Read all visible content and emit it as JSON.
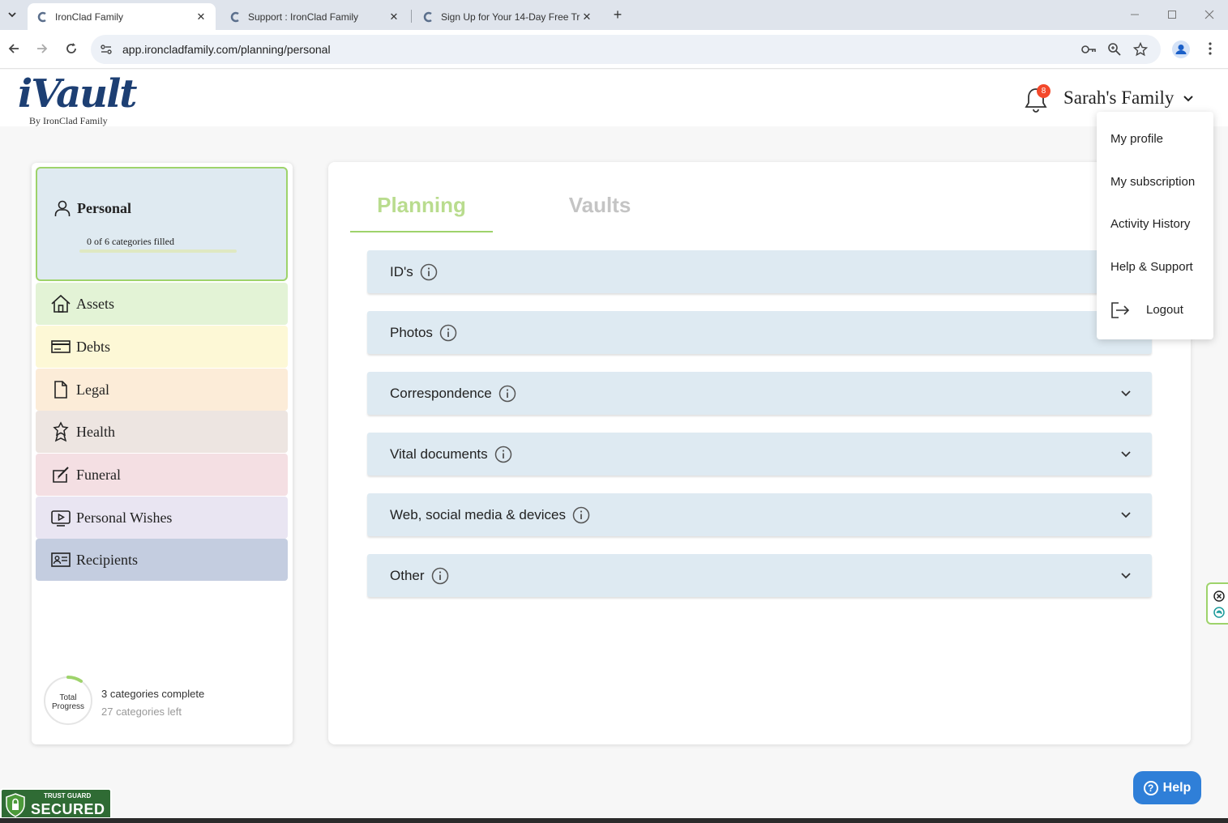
{
  "browser": {
    "tabs": [
      {
        "title": "IronClad Family",
        "active": true
      },
      {
        "title": "Support : IronClad Family",
        "active": false
      },
      {
        "title": "Sign Up for Your 14-Day Free Tr",
        "active": false
      }
    ],
    "url": "app.ironcladfamily.com/planning/personal"
  },
  "header": {
    "logo_main": "iVault",
    "logo_sub": "By IronClad Family",
    "notification_count": "8",
    "family_name": "Sarah's Family"
  },
  "sidebar": {
    "personal": {
      "title": "Personal",
      "subtitle": "0 of 6 categories filled",
      "progress_fraction": 0
    },
    "items": [
      {
        "label": "Assets",
        "icon": "house-icon",
        "color": "#e3f3d6"
      },
      {
        "label": "Debts",
        "icon": "credit-card-icon",
        "color": "#fdf8d6"
      },
      {
        "label": "Legal",
        "icon": "document-icon",
        "color": "#fcecd8"
      },
      {
        "label": "Health",
        "icon": "award-ribbon-icon",
        "color": "#ede5e1"
      },
      {
        "label": "Funeral",
        "icon": "edit-square-icon",
        "color": "#f4dfe3"
      },
      {
        "label": "Personal Wishes",
        "icon": "video-icon",
        "color": "#e9e5f2"
      },
      {
        "label": "Recipients",
        "icon": "contact-card-icon",
        "color": "#c4cde0"
      }
    ],
    "progress": {
      "ring_label": "Total Progress",
      "complete": "3 categories complete",
      "left": "27 categories left",
      "fraction": 0.1
    }
  },
  "main": {
    "tabs": [
      {
        "label": "Planning",
        "active": true
      },
      {
        "label": "Vaults",
        "active": false
      }
    ],
    "sections": [
      {
        "label": "ID's"
      },
      {
        "label": "Photos"
      },
      {
        "label": "Correspondence"
      },
      {
        "label": "Vital documents"
      },
      {
        "label": "Web, social media & devices"
      },
      {
        "label": "Other"
      }
    ]
  },
  "dropdown": {
    "items": [
      "My profile",
      "My subscription",
      "Activity History",
      "Help & Support",
      "Logout"
    ]
  },
  "help_button": "Help",
  "trust_badge": {
    "top": "TRUST GUARD",
    "bottom": "SECURED"
  },
  "colors": {
    "accent_green": "#9ed36b",
    "help_blue": "#2f7fd8",
    "badge_red": "#f3482a"
  }
}
